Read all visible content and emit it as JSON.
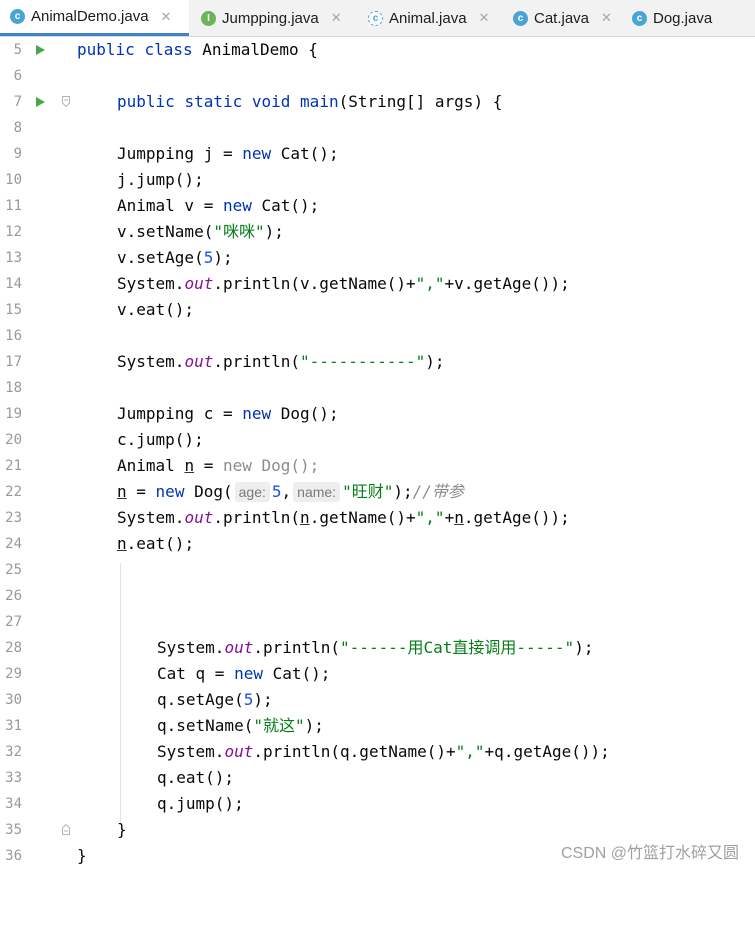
{
  "tabs": [
    {
      "label": "AnimalDemo.java",
      "icon": "class-icon",
      "active": true
    },
    {
      "label": "Jumpping.java",
      "icon": "interface-icon"
    },
    {
      "label": "Animal.java",
      "icon": "abstract-class-icon"
    },
    {
      "label": "Cat.java",
      "icon": "class-icon"
    },
    {
      "label": "Dog.java",
      "icon": "class-icon"
    }
  ],
  "close_glyph": "✕",
  "editor": {
    "line_numbers": [
      "5",
      "6",
      "7",
      "8",
      "9",
      "10",
      "11",
      "12",
      "13",
      "14",
      "15",
      "16",
      "17",
      "18",
      "19",
      "20",
      "21",
      "22",
      "23",
      "24",
      "25",
      "26",
      "27",
      "28",
      "29",
      "30",
      "31",
      "32",
      "33",
      "34",
      "35",
      "36"
    ],
    "code": {
      "l5": [
        "public",
        "class",
        "AnimalDemo {"
      ],
      "l7": [
        "public",
        "static",
        "void",
        "main",
        "(String[] args) {"
      ],
      "l9": [
        "Jumpping j = ",
        "new",
        " Cat();"
      ],
      "l10": "j.jump();",
      "l11": [
        "Animal v = ",
        "new",
        " Cat();"
      ],
      "l12": [
        "v.setName(",
        "\"咪咪\"",
        ");"
      ],
      "l13": [
        "v.setAge(",
        "5",
        ");"
      ],
      "l14": [
        "System.",
        "out",
        ".println(v.getName()+",
        "\",\"",
        "+v.getAge());"
      ],
      "l15": "v.eat();",
      "l17": [
        "System.",
        "out",
        ".println(",
        "\"-----------\"",
        ");"
      ],
      "l19": [
        "Jumpping c = ",
        "new",
        " Dog();"
      ],
      "l20": "c.jump();",
      "l21": [
        "Animal ",
        "n",
        " = ",
        "new Dog();"
      ],
      "l22": [
        "n",
        " = ",
        "new",
        " Dog(",
        "age:",
        "5",
        ",",
        "name:",
        "\"旺财\"",
        ");",
        "//带参"
      ],
      "l23": [
        "System.",
        "out",
        ".println(",
        "n",
        ".getName()+",
        "\",\"",
        "+",
        "n",
        ".getAge());"
      ],
      "l24": [
        "n",
        ".eat();"
      ],
      "l28": [
        "System.",
        "out",
        ".println(",
        "\"------用Cat直接调用-----\"",
        ");"
      ],
      "l29": [
        "Cat q = ",
        "new",
        " Cat();"
      ],
      "l30": [
        "q.setAge(",
        "5",
        ");"
      ],
      "l31": [
        "q.setName(",
        "\"就这\"",
        ");"
      ],
      "l32": [
        "System.",
        "out",
        ".println(q.getName()+",
        "\",\"",
        "+q.getAge());"
      ],
      "l33": "q.eat();",
      "l34": "q.jump();",
      "l35": "}",
      "l36": "}"
    }
  },
  "watermark": "CSDN @竹篮打水碎又圆",
  "colors": {
    "keyword": "#0033b3",
    "string": "#067d17",
    "number": "#1750eb",
    "static_field": "#871094",
    "comment": "#8c8c8c",
    "run_marker": "#4aa64a",
    "active_tab_underline": "#4083c9"
  }
}
